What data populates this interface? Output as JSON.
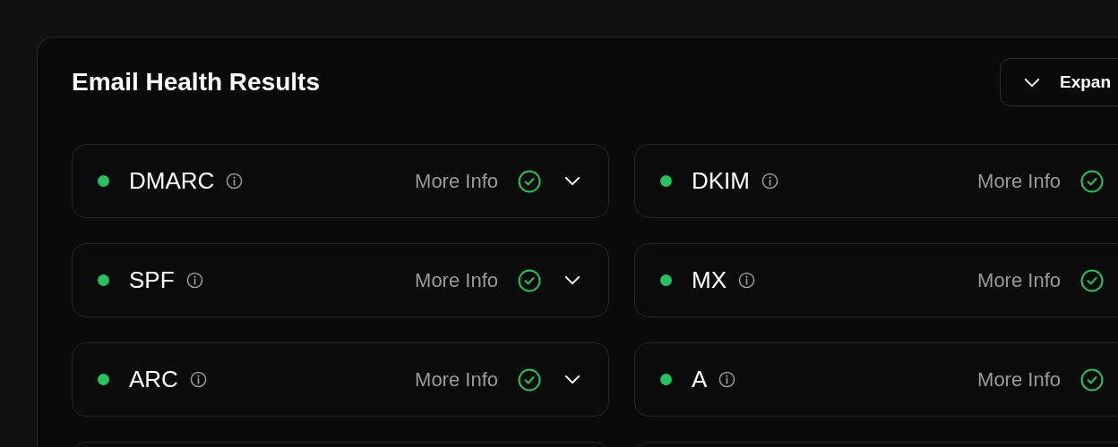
{
  "title": "Email Health Results",
  "expand_button": {
    "label": "Expan"
  },
  "results": [
    {
      "name": "DMARC",
      "link": "More Info",
      "color": "#22c55e",
      "passed": true
    },
    {
      "name": "DKIM",
      "link": "More Info",
      "color": "#22c55e",
      "passed": true
    },
    {
      "name": "SPF",
      "link": "More Info",
      "color": "#22c55e",
      "passed": true
    },
    {
      "name": "MX",
      "link": "More Info",
      "color": "#22c55e",
      "passed": true
    },
    {
      "name": "ARC",
      "link": "More Info",
      "color": "#22c55e",
      "passed": true
    },
    {
      "name": "A",
      "link": "More Info",
      "color": "#22c55e",
      "passed": true
    }
  ]
}
